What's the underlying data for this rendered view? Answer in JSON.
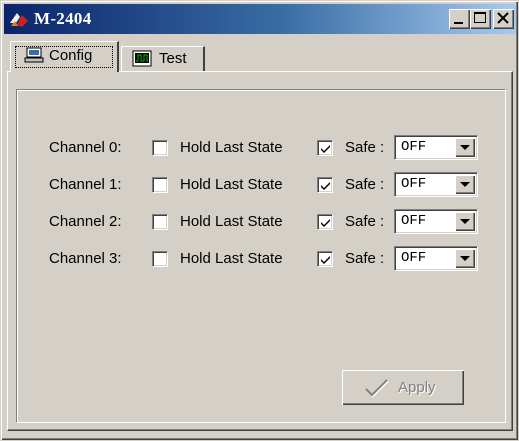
{
  "window": {
    "title": "M-2404",
    "buttons": {
      "minimize": "minimize",
      "maximize": "maximize",
      "close": "close"
    }
  },
  "tabs": [
    {
      "label": "Config",
      "icon": "network-config-icon",
      "selected": true
    },
    {
      "label": "Test",
      "icon": "waveform-icon",
      "selected": false
    }
  ],
  "channels": [
    {
      "label": "Channel 0:",
      "hold_label": "Hold Last State",
      "hold_checked": false,
      "safe_label": "Safe :",
      "safe_checked": true,
      "safe_value": "OFF"
    },
    {
      "label": "Channel 1:",
      "hold_label": "Hold Last State",
      "hold_checked": false,
      "safe_label": "Safe :",
      "safe_checked": true,
      "safe_value": "OFF"
    },
    {
      "label": "Channel 2:",
      "hold_label": "Hold Last State",
      "hold_checked": false,
      "safe_label": "Safe :",
      "safe_checked": true,
      "safe_value": "OFF"
    },
    {
      "label": "Channel 3:",
      "hold_label": "Hold Last State",
      "hold_checked": false,
      "safe_label": "Safe :",
      "safe_checked": true,
      "safe_value": "OFF"
    }
  ],
  "apply": {
    "label": "Apply",
    "enabled": false,
    "icon": "checkmark-icon"
  },
  "colors": {
    "face": "#d4d0c8",
    "title_start": "#0a246a",
    "title_end": "#a6caf0",
    "disabled_text": "#808080"
  }
}
